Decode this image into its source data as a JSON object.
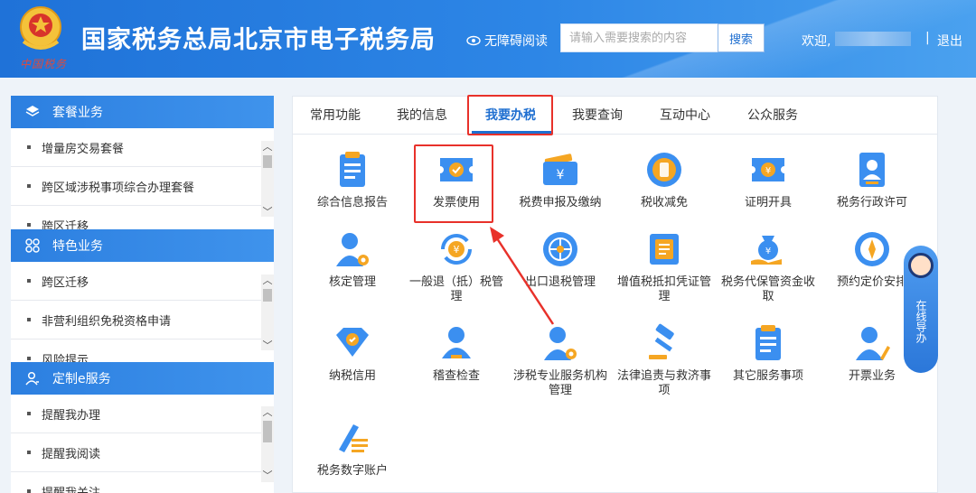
{
  "header": {
    "title": "国家税务总局北京市电子税务局",
    "emblem_signature": "中国税务",
    "accessibility_label": "无障碍阅读",
    "search_placeholder": "请输入需要搜索的内容",
    "search_button": "搜索",
    "welcome": "欢迎,",
    "separator": "|",
    "logout": "退出",
    "accent": "#2d86e6"
  },
  "sidebar": {
    "sections": [
      {
        "title": "套餐业务",
        "icon": "layers-icon",
        "items": [
          "增量房交易套餐",
          "跨区域涉税事项综合办理套餐",
          "跨区迁移"
        ]
      },
      {
        "title": "特色业务",
        "icon": "grid-icon",
        "items": [
          "跨区迁移",
          "非营利组织免税资格申请",
          "风险提示"
        ]
      },
      {
        "title": "定制e服务",
        "icon": "user-icon",
        "items": [
          "提醒我办理",
          "提醒我阅读",
          "提醒我关注"
        ]
      }
    ]
  },
  "tabs": [
    {
      "label": "常用功能"
    },
    {
      "label": "我的信息"
    },
    {
      "label": "我要办税",
      "active": true
    },
    {
      "label": "我要查询"
    },
    {
      "label": "互动中心"
    },
    {
      "label": "公众服务"
    }
  ],
  "functions": [
    {
      "label": "综合信息报告",
      "icon": "report-doc-icon"
    },
    {
      "label": "发票使用",
      "icon": "invoice-ticket-icon",
      "highlighted": true
    },
    {
      "label": "税费申报及缴纳",
      "icon": "wallet-yuan-icon"
    },
    {
      "label": "税收减免",
      "icon": "tax-reduction-badge-icon"
    },
    {
      "label": "证明开具",
      "icon": "certificate-ticket-icon"
    },
    {
      "label": "税务行政许可",
      "icon": "id-card-icon"
    },
    {
      "label": "核定管理",
      "icon": "user-gear-icon"
    },
    {
      "label": "一般退（抵）税管理",
      "icon": "refund-cycle-icon"
    },
    {
      "label": "出口退税管理",
      "icon": "globe-icon"
    },
    {
      "label": "增值税抵扣凭证管理",
      "icon": "vat-document-icon"
    },
    {
      "label": "税务代保管资金收取",
      "icon": "money-bag-hand-icon"
    },
    {
      "label": "预约定价安排",
      "icon": "compass-icon"
    },
    {
      "label": "纳税信用",
      "icon": "credit-diamond-icon"
    },
    {
      "label": "稽查检查",
      "icon": "user-check-icon"
    },
    {
      "label": "涉税专业服务机构管理",
      "icon": "agency-user-gear-icon"
    },
    {
      "label": "法律追责与救济事项",
      "icon": "gavel-icon"
    },
    {
      "label": "其它服务事项",
      "icon": "clipboard-list-icon"
    },
    {
      "label": "开票业务",
      "icon": "user-pen-icon"
    },
    {
      "label": "税务数字账户",
      "icon": "digital-account-pen-icon"
    }
  ],
  "online_guide": {
    "label": "在线导办"
  },
  "colors": {
    "highlight_red": "#e8312a",
    "tab_active": "#1f6fd0",
    "icon_blue": "#3b8ff0",
    "icon_orange": "#f5a623"
  }
}
